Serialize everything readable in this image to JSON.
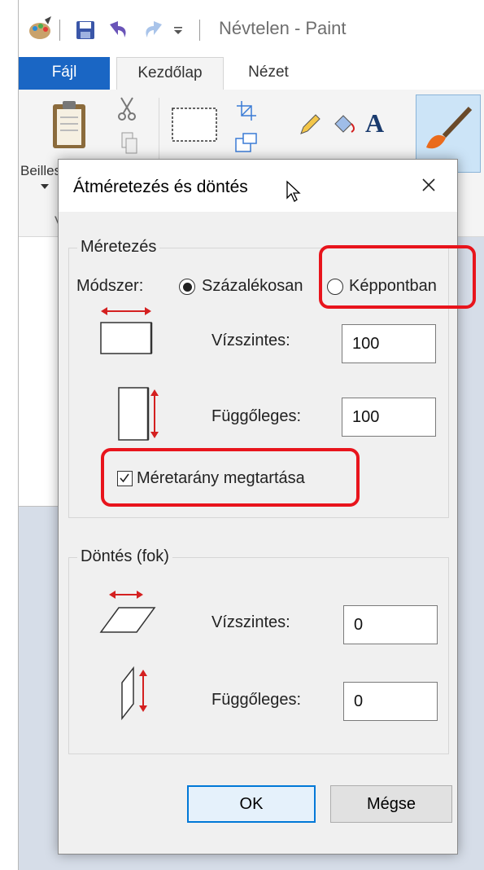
{
  "window": {
    "title": "Névtelen - Paint",
    "tabs": {
      "file": "Fájl",
      "home": "Kezdőlap",
      "view": "Nézet"
    },
    "ribbon": {
      "paste_label": "Beilles",
      "clipboard_group_label": "Vá"
    }
  },
  "dialog": {
    "title": "Átméretezés és döntés",
    "resize": {
      "group_title": "Méretezés",
      "method_label": "Módszer:",
      "option_percent": "Százalékosan",
      "option_pixels": "Képpontban",
      "selected": "percent",
      "horizontal_label": "Vízszintes:",
      "horizontal_value": "100",
      "vertical_label": "Függőleges:",
      "vertical_value": "100",
      "keep_ratio_label": "Méretarány megtartása",
      "keep_ratio_checked": true
    },
    "skew": {
      "group_title": "Döntés (fok)",
      "horizontal_label": "Vízszintes:",
      "horizontal_value": "0",
      "vertical_label": "Függőleges:",
      "vertical_value": "0"
    },
    "buttons": {
      "ok": "OK",
      "cancel": "Mégse"
    }
  },
  "colors": {
    "accent": "#1a66c4",
    "highlight": "#e8141c",
    "arrow": "#d42020"
  }
}
